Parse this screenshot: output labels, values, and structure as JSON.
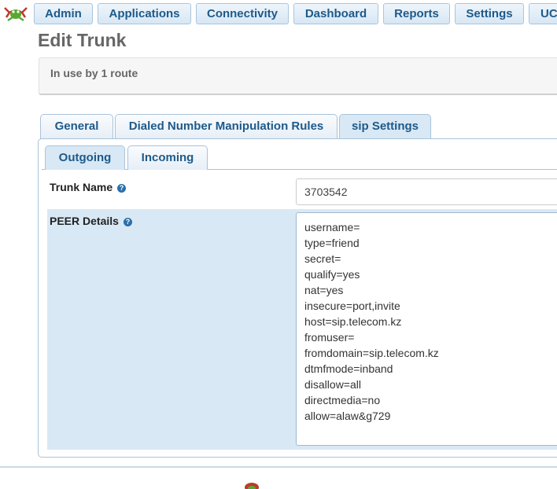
{
  "nav": {
    "items": [
      "Admin",
      "Applications",
      "Connectivity",
      "Dashboard",
      "Reports",
      "Settings",
      "UC"
    ]
  },
  "page": {
    "title": "Edit Trunk",
    "in_use": "In use by 1 route"
  },
  "tabs": [
    "General",
    "Dialed Number Manipulation Rules",
    "sip Settings"
  ],
  "subtabs": [
    "Outgoing",
    "Incoming"
  ],
  "form": {
    "trunk_name_label": "Trunk Name",
    "trunk_name_value": "3703542",
    "peer_label": "PEER Details",
    "help_glyph": "?",
    "peer_lines": [
      "username=",
      "type=friend",
      "secret=",
      "qualify=yes",
      "nat=yes",
      "insecure=port,invite",
      "host=sip.telecom.kz",
      "fromuser=",
      "fromdomain=sip.telecom.kz",
      "dtmfmode=inband",
      "disallow=all",
      "directmedia=no",
      "allow=alaw&g729"
    ]
  },
  "colors": {
    "accent": "#1d5a8a",
    "highlight_row": "#d9e8f5"
  }
}
